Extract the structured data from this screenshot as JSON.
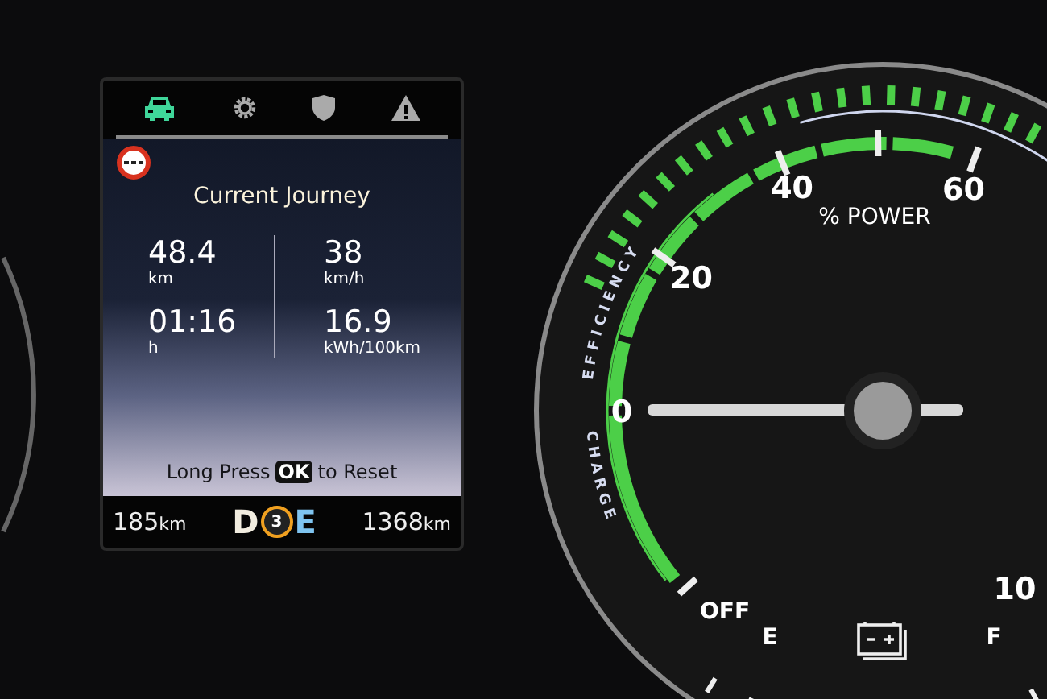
{
  "trip_screen": {
    "tabs": [
      {
        "kind": "car",
        "selected": true
      },
      {
        "kind": "gear",
        "selected": false
      },
      {
        "kind": "shield",
        "selected": false
      },
      {
        "kind": "warning",
        "selected": false
      }
    ],
    "title": "Current Journey",
    "stats": [
      {
        "value": "48.4",
        "unit": "km"
      },
      {
        "value": "38",
        "unit": "km/h"
      },
      {
        "value": "01:16",
        "unit": "h"
      },
      {
        "value": "16.9",
        "unit": "kWh/100km"
      }
    ],
    "reset_hint": {
      "before": "Long Press",
      "key": "OK",
      "after": "to Reset"
    },
    "status_bar": {
      "range": {
        "value": "185",
        "unit": "km"
      },
      "gear": {
        "left": "D",
        "eco_level": "3",
        "right": "E"
      },
      "odometer": {
        "value": "1368",
        "unit": "km"
      }
    }
  },
  "power_gauge": {
    "scale_labels": [
      "0",
      "20",
      "40",
      "60"
    ],
    "title": "% POWER",
    "zone_labels": {
      "efficiency": "EFFICIENCY",
      "charge": "CHARGE"
    },
    "off_label": "OFF",
    "battery_gauge": {
      "empty": "E",
      "full": "F"
    },
    "outer_label": "10"
  }
}
